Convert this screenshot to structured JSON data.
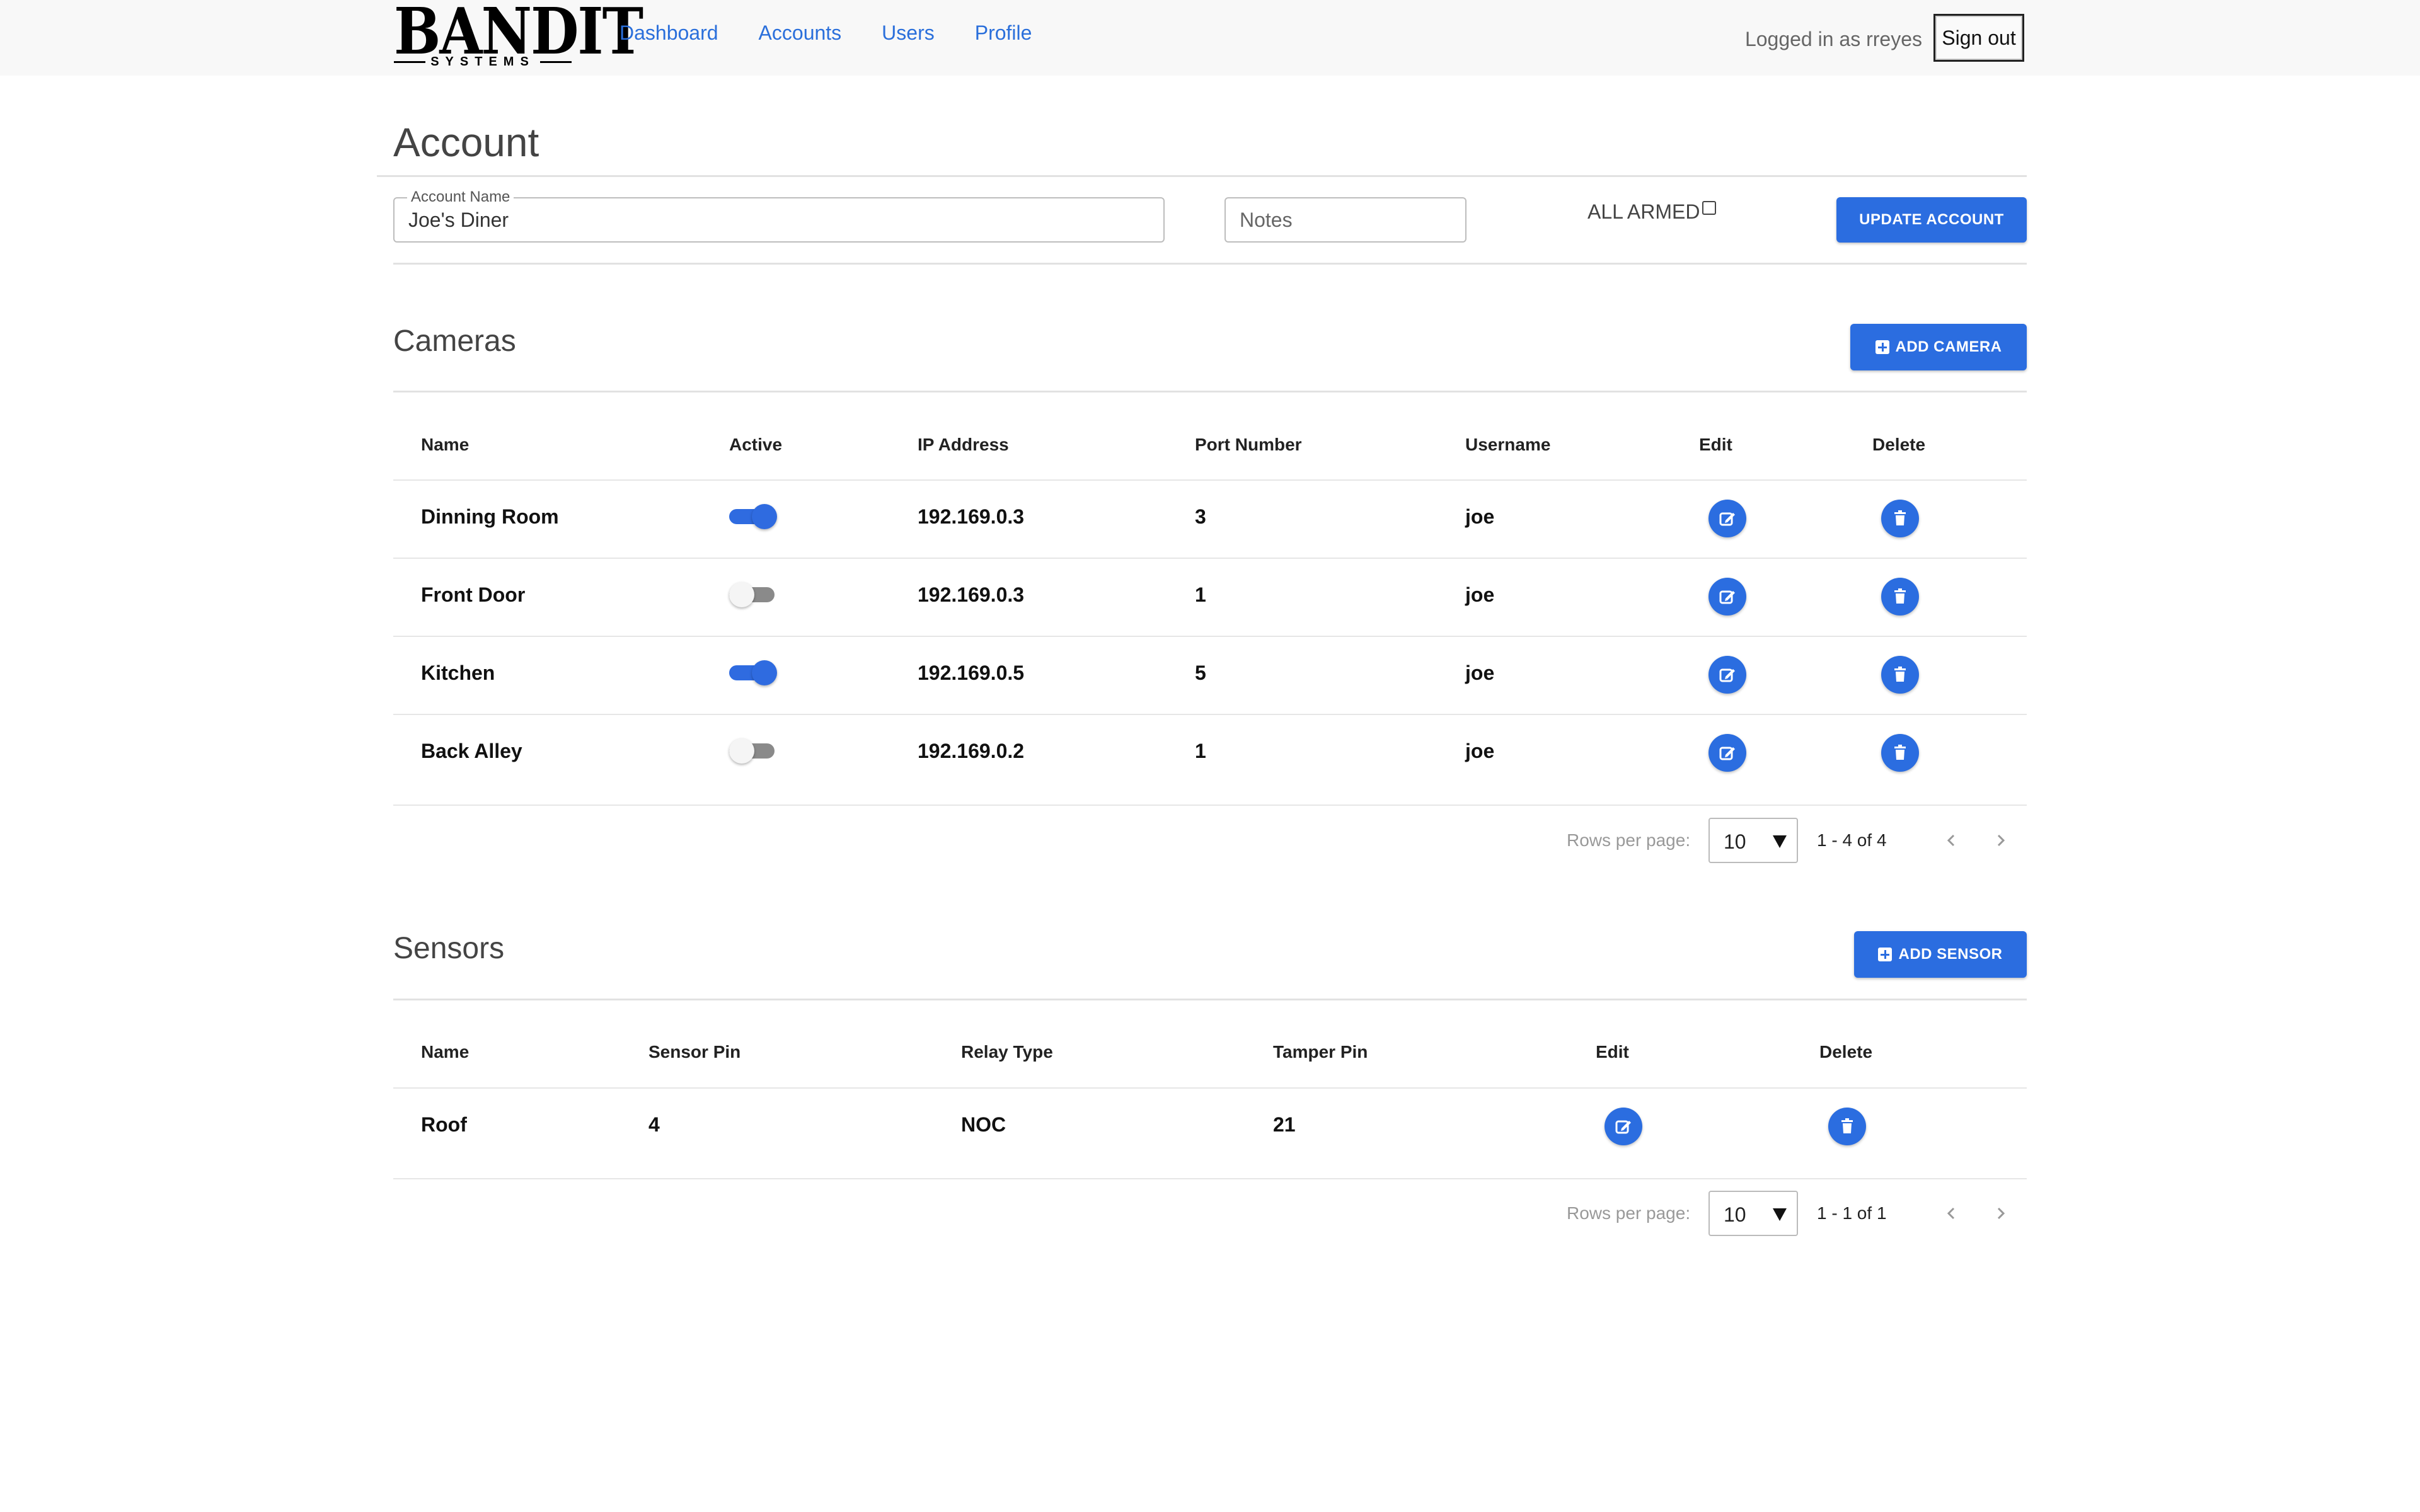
{
  "header": {
    "logo": {
      "main": "BANDIT",
      "sub": "SYSTEMS"
    },
    "nav": [
      "Dashboard",
      "Accounts",
      "Users",
      "Profile"
    ],
    "logged_in_text": "Logged in as rreyes",
    "sign_out_label": "Sign out",
    "link_color": "#2a6fdb"
  },
  "account": {
    "title": "Account",
    "name_label": "Account Name",
    "name_value": "Joe's Diner",
    "notes_placeholder": "Notes",
    "all_armed_label": "ALL ARMED",
    "all_armed_checked": false,
    "update_button": "UPDATE ACCOUNT"
  },
  "cameras": {
    "title": "Cameras",
    "add_button": "ADD CAMERA",
    "columns": [
      "Name",
      "Active",
      "IP Address",
      "Port Number",
      "Username",
      "Edit",
      "Delete"
    ],
    "rows": [
      {
        "name": "Dinning Room",
        "active": true,
        "ip": "192.169.0.3",
        "port": "3",
        "username": "joe"
      },
      {
        "name": "Front Door",
        "active": false,
        "ip": "192.169.0.3",
        "port": "1",
        "username": "joe"
      },
      {
        "name": "Kitchen",
        "active": true,
        "ip": "192.169.0.5",
        "port": "5",
        "username": "joe"
      },
      {
        "name": "Back Alley",
        "active": false,
        "ip": "192.169.0.2",
        "port": "1",
        "username": "joe"
      }
    ],
    "pager": {
      "rows_per_page_label": "Rows per page:",
      "rows_per_page": "10",
      "range": "1 - 4 of 4"
    }
  },
  "sensors": {
    "title": "Sensors",
    "add_button": "ADD SENSOR",
    "columns": [
      "Name",
      "Sensor Pin",
      "Relay Type",
      "Tamper Pin",
      "Edit",
      "Delete"
    ],
    "rows": [
      {
        "name": "Roof",
        "sensor_pin": "4",
        "relay_type": "NOC",
        "tamper_pin": "21"
      }
    ],
    "pager": {
      "rows_per_page_label": "Rows per page:",
      "rows_per_page": "10",
      "range": "1 - 1 of 1"
    }
  },
  "colors": {
    "primary": "#2b6de0",
    "toggle_off": "#8a8a8a"
  },
  "icons": {
    "edit": "edit-icon",
    "delete": "trash-icon",
    "add": "plus-square-icon",
    "prev": "chevron-left-icon",
    "next": "chevron-right-icon",
    "dropdown": "caret-down-icon"
  }
}
